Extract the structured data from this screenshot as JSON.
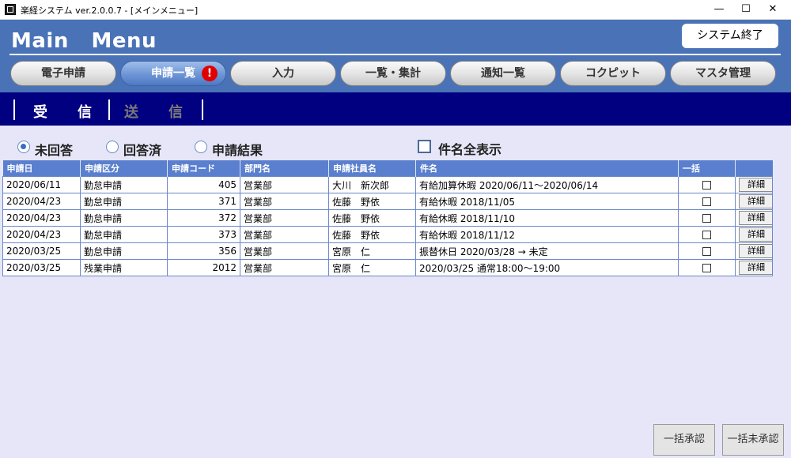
{
  "window": {
    "title": "楽経システム ver.2.0.0.7 - [メインメニュー]",
    "minimize": "—",
    "maximize": "☐",
    "close": "✕"
  },
  "header": {
    "title": "Main   Menu",
    "exit_button": "システム終了"
  },
  "nav": {
    "items": [
      {
        "label": "電子申請"
      },
      {
        "label": "申請一覧",
        "active": true,
        "badge": "!"
      },
      {
        "label": "入力"
      },
      {
        "label": "一覧・集計"
      },
      {
        "label": "通知一覧"
      },
      {
        "label": "コクピット"
      },
      {
        "label": "マスタ管理"
      }
    ]
  },
  "subtabs": {
    "received": "受信",
    "sent": "送信"
  },
  "filters": {
    "unanswered": "未回答",
    "answered": "回答済",
    "result": "申請結果",
    "show_full_subject": "件名全表示"
  },
  "table": {
    "headers": [
      "申請日",
      "申請区分",
      "申請コード",
      "部門名",
      "申請社員名",
      "件名",
      "一括",
      ""
    ],
    "detail_label": "詳細",
    "rows": [
      {
        "date": "2020/06/11",
        "type": "勤怠申請",
        "code": "405",
        "dept": "営業部",
        "employee": "大川　新次郎",
        "subject": "有給加算休暇 2020/06/11～2020/06/14"
      },
      {
        "date": "2020/04/23",
        "type": "勤怠申請",
        "code": "371",
        "dept": "営業部",
        "employee": "佐藤　野依",
        "subject": "有給休暇 2018/11/05"
      },
      {
        "date": "2020/04/23",
        "type": "勤怠申請",
        "code": "372",
        "dept": "営業部",
        "employee": "佐藤　野依",
        "subject": "有給休暇 2018/11/10"
      },
      {
        "date": "2020/04/23",
        "type": "勤怠申請",
        "code": "373",
        "dept": "営業部",
        "employee": "佐藤　野依",
        "subject": "有給休暇 2018/11/12"
      },
      {
        "date": "2020/03/25",
        "type": "勤怠申請",
        "code": "356",
        "dept": "営業部",
        "employee": "宮原　仁",
        "subject": "振替休日 2020/03/28 → 未定"
      },
      {
        "date": "2020/03/25",
        "type": "残業申請",
        "code": "2012",
        "dept": "営業部",
        "employee": "宮原　仁",
        "subject": "2020/03/25 通常18:00～19:00"
      }
    ]
  },
  "footer": {
    "bulk_approve": "一括承認",
    "bulk_unapprove": "一括未承認"
  },
  "colors": {
    "header_bg": "#4a72b6",
    "subtab_bg": "#000080",
    "content_bg": "#e6e6f8",
    "table_header_bg": "#5a7fce",
    "badge": "#e00000"
  }
}
